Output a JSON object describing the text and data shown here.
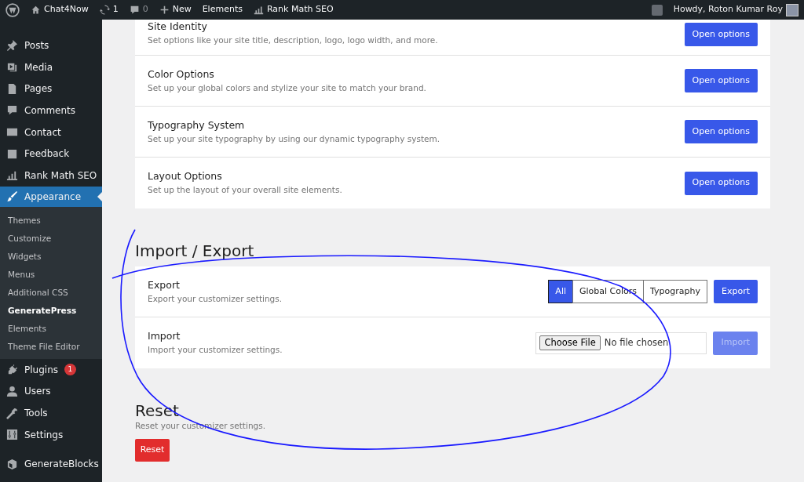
{
  "admin_bar": {
    "site": "Chat4Now",
    "updates": "1",
    "comments": "0",
    "new": "New",
    "elements": "Elements",
    "rank_math": "Rank Math SEO",
    "greeting": "Howdy, Roton Kumar Roy"
  },
  "sidebar": [
    {
      "label": "Posts",
      "current": false
    },
    {
      "label": "Media",
      "current": false
    },
    {
      "label": "Pages",
      "current": false
    },
    {
      "label": "Comments",
      "current": false
    },
    {
      "label": "Contact",
      "current": false
    },
    {
      "label": "Feedback",
      "current": false
    },
    {
      "label": "Rank Math SEO",
      "current": false
    },
    {
      "label": "Appearance",
      "current": true,
      "children": [
        {
          "label": "Themes",
          "selected": false
        },
        {
          "label": "Customize",
          "selected": false
        },
        {
          "label": "Widgets",
          "selected": false
        },
        {
          "label": "Menus",
          "selected": false
        },
        {
          "label": "Additional CSS",
          "selected": false
        },
        {
          "label": "GeneratePress",
          "selected": true
        },
        {
          "label": "Elements",
          "selected": false
        },
        {
          "label": "Theme File Editor",
          "selected": false
        }
      ]
    },
    {
      "label": "Plugins",
      "current": false,
      "badge": "1"
    },
    {
      "label": "Users",
      "current": false
    },
    {
      "label": "Tools",
      "current": false
    },
    {
      "label": "Settings",
      "current": false
    },
    {
      "label": "GenerateBlocks",
      "current": false
    }
  ],
  "options": [
    {
      "title": "Site Identity",
      "description": "Set options like your site title, description, logo, logo width, and more.",
      "button": "Open options"
    },
    {
      "title": "Color Options",
      "description": "Set up your global colors and stylize your site to match your brand.",
      "button": "Open options"
    },
    {
      "title": "Typography System",
      "description": "Set up your site typography by using our dynamic typography system.",
      "button": "Open options"
    },
    {
      "title": "Layout Options",
      "description": "Set up the layout of your overall site elements.",
      "button": "Open options"
    }
  ],
  "import_export": {
    "heading": "Import / Export",
    "export": {
      "title": "Export",
      "description": "Export your customizer settings.",
      "toggles": [
        {
          "label": "All",
          "selected": true
        },
        {
          "label": "Global Colors",
          "selected": false
        },
        {
          "label": "Typography",
          "selected": false
        }
      ],
      "button": "Export"
    },
    "import": {
      "title": "Import",
      "description": "Import your customizer settings.",
      "file_button": "Choose File",
      "file_status": "No file chosen",
      "button": "Import",
      "disabled": true
    }
  },
  "reset": {
    "heading": "Reset",
    "description": "Reset your customizer settings.",
    "button": "Reset"
  }
}
